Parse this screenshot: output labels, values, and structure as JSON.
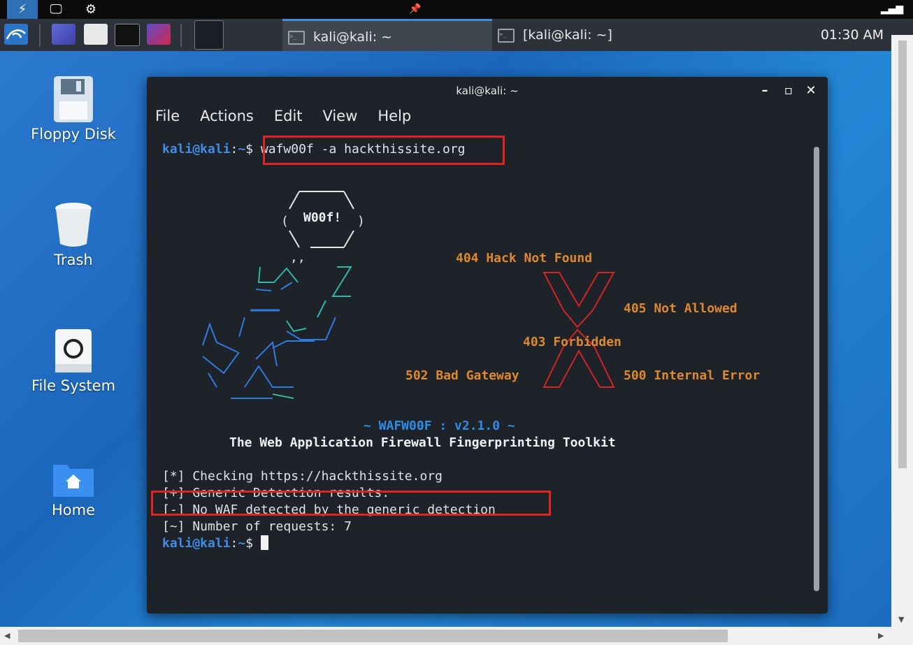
{
  "system_bar": {
    "bolt_icon": "bolt-icon",
    "desktop_icon": "monitor-icon",
    "settings_icon": "gear-icon",
    "pin_icon": "pin-icon",
    "signal_icon": "signal-icon"
  },
  "taskbar": {
    "tasks": [
      {
        "label": "kali@kali: ~",
        "active": true
      },
      {
        "label": "[kali@kali: ~]",
        "active": false
      }
    ],
    "clock": "01:30 AM"
  },
  "desktop": {
    "icons": [
      {
        "label": "Floppy Disk",
        "icon": "floppy-icon"
      },
      {
        "label": "Trash",
        "icon": "trash-icon"
      },
      {
        "label": "File System",
        "icon": "drive-icon"
      },
      {
        "label": "Home",
        "icon": "home-folder-icon"
      }
    ]
  },
  "terminal": {
    "title": "kali@kali: ~",
    "menu": [
      "File",
      "Actions",
      "Edit",
      "View",
      "Help"
    ],
    "prompt_user": "kali@kali",
    "prompt_sep": ":",
    "prompt_path": "~",
    "prompt_symbol": "$ ",
    "command": "wafw00f -a hackthissite.org",
    "banner": {
      "woof": "W00f!",
      "err404": "404 Hack Not Found",
      "err405": "405 Not Allowed",
      "err403": "403 Forbidden",
      "err502": "502 Bad Gateway",
      "err500": "500 Internal Error",
      "version": "~ WAFW00F : v2.1.0 ~",
      "tagline": "The Web Application Firewall Fingerprinting Toolkit"
    },
    "output": [
      "[*] Checking https://hackthissite.org",
      "[+] Generic Detection results:",
      "[-] No WAF detected by the generic detection",
      "[~] Number of requests: 7"
    ]
  },
  "colors": {
    "accent_blue": "#3f8de6",
    "orange": "#e0892c",
    "red_box": "#e02424",
    "terminal_bg": "#1e2229"
  }
}
